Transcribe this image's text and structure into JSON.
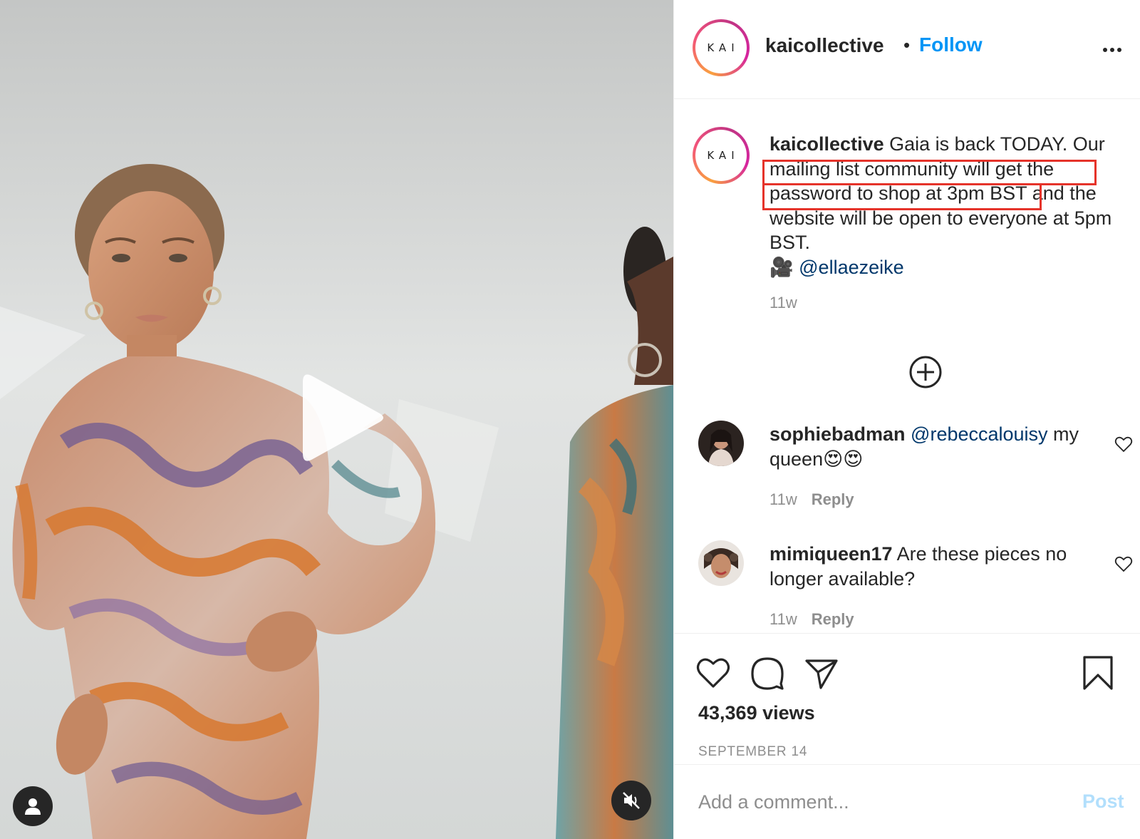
{
  "post": {
    "author": "kaicollective",
    "follow_label": "Follow",
    "separator": "•",
    "avatar_text": "KAI"
  },
  "caption": {
    "username": "kaicollective",
    "text_part1": " Gaia is back TODAY. Our ",
    "highlight1": "mailing list community will get the",
    "text_part2": " ",
    "highlight2": "password to shop at 3pm BST",
    "text_part3": " and the website will be open to everyone at 5pm BST.",
    "camera_emoji": "🎥",
    "mention": "@ellaezeike",
    "time": "11w"
  },
  "comments": [
    {
      "username": "sophiebadman",
      "mention": "@rebeccalouisy",
      "text": " my queen😍😍",
      "time": "11w",
      "reply_label": "Reply"
    },
    {
      "username": "mimiqueen17",
      "mention": "",
      "text": " Are these pieces no longer available?",
      "time": "11w",
      "reply_label": "Reply"
    }
  ],
  "stats": {
    "views": "43,369 views",
    "date": "SEPTEMBER 14"
  },
  "comment_box": {
    "placeholder": "Add a comment...",
    "post_label": "Post"
  },
  "colors": {
    "accent": "#0095f6",
    "highlight_box": "#e5332a",
    "mention": "#00376b",
    "muted": "#8e8e8e"
  },
  "icons": {
    "media_user": "user-icon",
    "media_mute": "muted-speaker-icon",
    "play": "play-icon",
    "more": "more-options-icon",
    "load_more": "plus-circle-icon",
    "like": "heart-icon",
    "comment": "comment-icon",
    "share": "paper-plane-icon",
    "save": "bookmark-icon"
  }
}
